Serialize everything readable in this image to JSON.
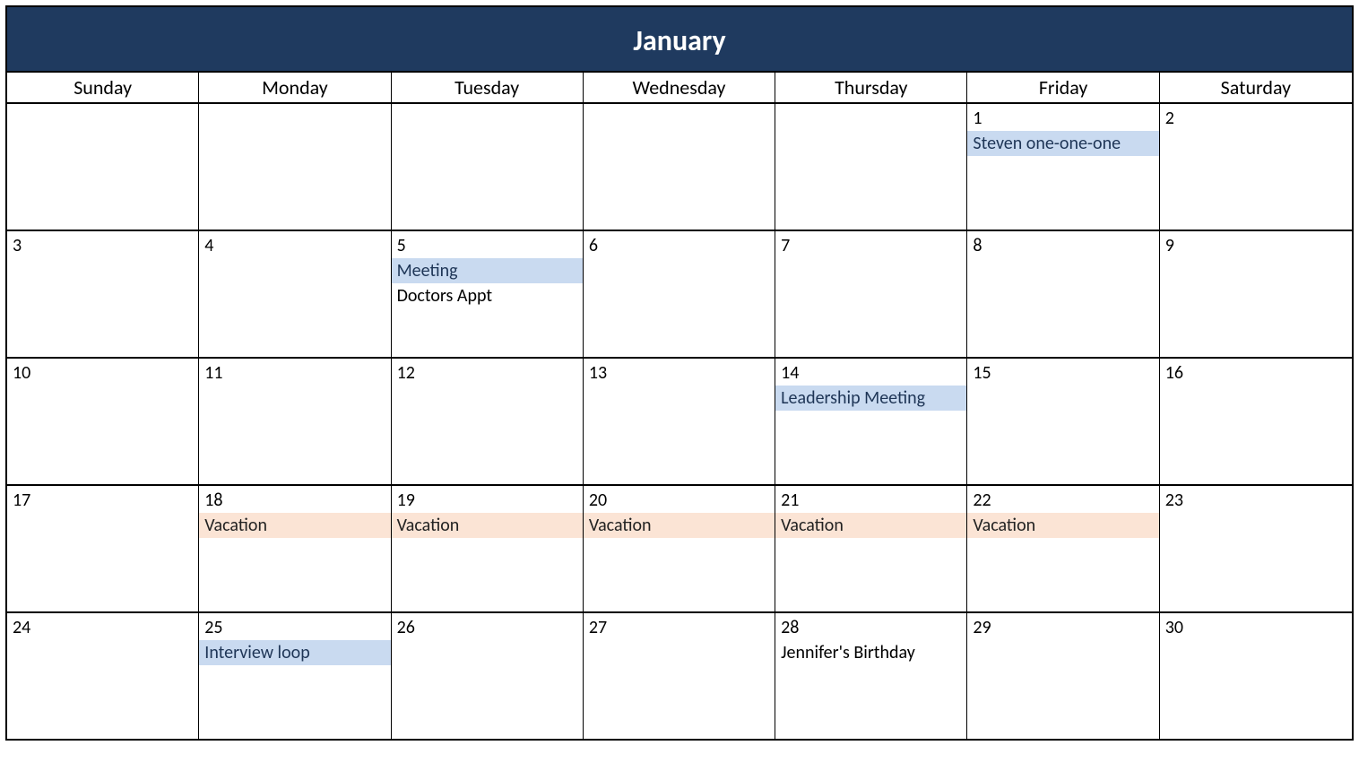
{
  "month_title": "January",
  "days_of_week": [
    "Sunday",
    "Monday",
    "Tuesday",
    "Wednesday",
    "Thursday",
    "Friday",
    "Saturday"
  ],
  "colors": {
    "header_bg": "#1f3a5f",
    "event_blue": "#c9daf0",
    "event_peach": "#fbe4d5"
  },
  "weeks": [
    [
      {
        "day": ""
      },
      {
        "day": ""
      },
      {
        "day": ""
      },
      {
        "day": ""
      },
      {
        "day": ""
      },
      {
        "day": "1",
        "events": [
          {
            "label": "Steven one-one-one",
            "style": "blue"
          }
        ]
      },
      {
        "day": "2"
      }
    ],
    [
      {
        "day": "3"
      },
      {
        "day": "4"
      },
      {
        "day": "5",
        "events": [
          {
            "label": "Meeting",
            "style": "blue"
          },
          {
            "label": "Doctors Appt",
            "style": "plain"
          }
        ]
      },
      {
        "day": "6"
      },
      {
        "day": "7"
      },
      {
        "day": "8"
      },
      {
        "day": "9"
      }
    ],
    [
      {
        "day": "10"
      },
      {
        "day": "11"
      },
      {
        "day": "12"
      },
      {
        "day": "13"
      },
      {
        "day": "14",
        "events": [
          {
            "label": "Leadership Meeting",
            "style": "blue"
          }
        ]
      },
      {
        "day": "15"
      },
      {
        "day": "16"
      }
    ],
    [
      {
        "day": "17"
      },
      {
        "day": "18",
        "events": [
          {
            "label": "Vacation",
            "style": "peach"
          }
        ]
      },
      {
        "day": "19",
        "events": [
          {
            "label": "Vacation",
            "style": "peach"
          }
        ]
      },
      {
        "day": "20",
        "events": [
          {
            "label": "Vacation",
            "style": "peach"
          }
        ]
      },
      {
        "day": "21",
        "events": [
          {
            "label": "Vacation",
            "style": "peach"
          }
        ]
      },
      {
        "day": "22",
        "events": [
          {
            "label": "Vacation",
            "style": "peach"
          }
        ]
      },
      {
        "day": "23"
      }
    ],
    [
      {
        "day": "24"
      },
      {
        "day": "25",
        "events": [
          {
            "label": "Interview loop",
            "style": "blue"
          }
        ]
      },
      {
        "day": "26"
      },
      {
        "day": "27"
      },
      {
        "day": "28",
        "events": [
          {
            "label": "Jennifer's Birthday",
            "style": "plain"
          }
        ]
      },
      {
        "day": "29"
      },
      {
        "day": "30"
      }
    ]
  ]
}
